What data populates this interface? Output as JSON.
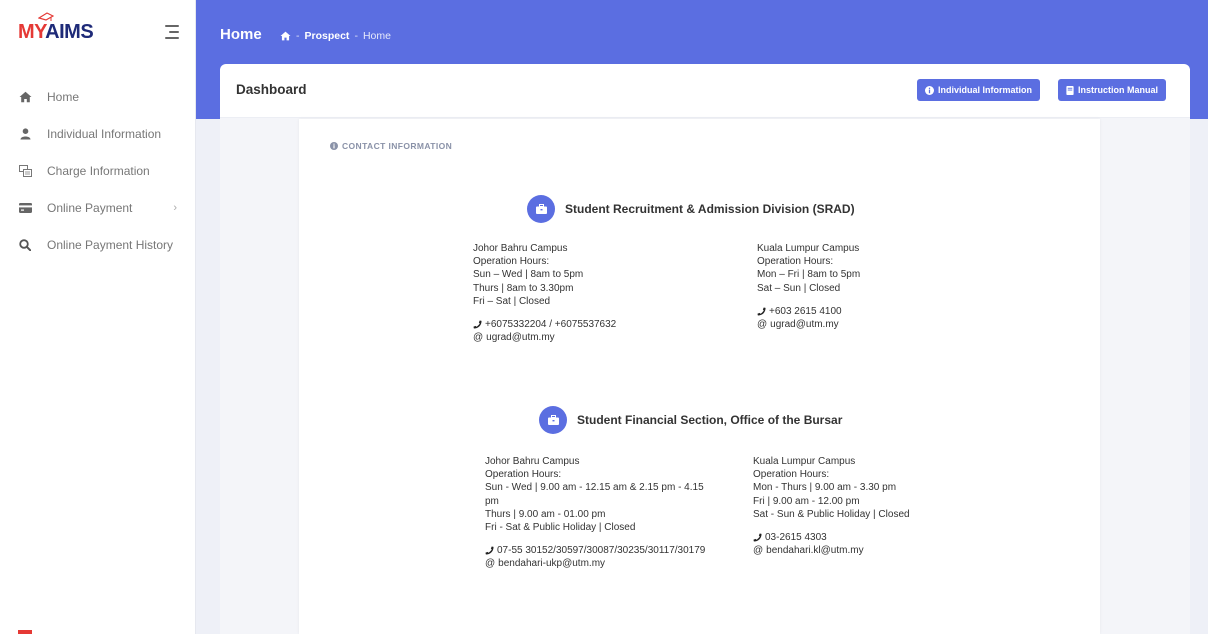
{
  "app": {
    "logo_my": "MY",
    "logo_aims": "AIMS"
  },
  "sidebar": {
    "items": [
      {
        "label": "Home",
        "icon": "home-icon"
      },
      {
        "label": "Individual Information",
        "icon": "user-icon"
      },
      {
        "label": "Charge Information",
        "icon": "charge-icon"
      },
      {
        "label": "Online Payment",
        "icon": "card-icon"
      },
      {
        "label": "Online Payment History",
        "icon": "search-icon"
      }
    ]
  },
  "topbar": {
    "title": "Home",
    "breadcrumb": [
      "Prospect",
      "Home"
    ],
    "breadcrumb_sep": "-"
  },
  "header": {
    "title": "Dashboard",
    "btn_info": "Individual Information",
    "btn_manual": "Instruction Manual"
  },
  "contact": {
    "section_title": "CONTACT INFORMATION",
    "orgs": [
      {
        "name": "Student Recruitment & Admission Division (SRAD)",
        "left": {
          "campus": "Johor Bahru Campus",
          "hours_label": "Operation Hours:",
          "lines": [
            "Sun – Wed | 8am to 5pm",
            "Thurs | 8am to 3.30pm",
            "Fri – Sat | Closed"
          ],
          "phone": "+6075332204 / +6075537632",
          "email": "ugrad@utm.my"
        },
        "right": {
          "campus": "Kuala Lumpur Campus",
          "hours_label": "Operation Hours:",
          "lines": [
            "Mon – Fri | 8am to 5pm",
            "Sat – Sun | Closed"
          ],
          "phone": "+603 2615 4100",
          "email": "ugrad@utm.my"
        }
      },
      {
        "name": "Student Financial Section, Office of the Bursar",
        "left": {
          "campus": "Johor Bahru Campus",
          "hours_label": "Operation Hours:",
          "lines": [
            "Sun - Wed | 9.00 am - 12.15 am & 2.15 pm - 4.15",
            "pm",
            "Thurs | 9.00 am - 01.00 pm",
            "Fri - Sat & Public Holiday | Closed"
          ],
          "phone": "07-55 30152/30597/30087/30235/30117/30179",
          "email": "bendahari-ukp@utm.my"
        },
        "right": {
          "campus": "Kuala Lumpur Campus",
          "hours_label": "Operation Hours:",
          "lines": [
            "Mon - Thurs | 9.00 am - 3.30 pm",
            "Fri | 9.00 am - 12.00 pm",
            "Sat - Sun & Public Holiday | Closed"
          ],
          "phone": "03-2615 4303",
          "email": "bendahari.kl@utm.my"
        }
      }
    ]
  },
  "colors": {
    "primary": "#5b6ee1",
    "logo_red": "#e53935",
    "logo_navy": "#1e2a78"
  }
}
